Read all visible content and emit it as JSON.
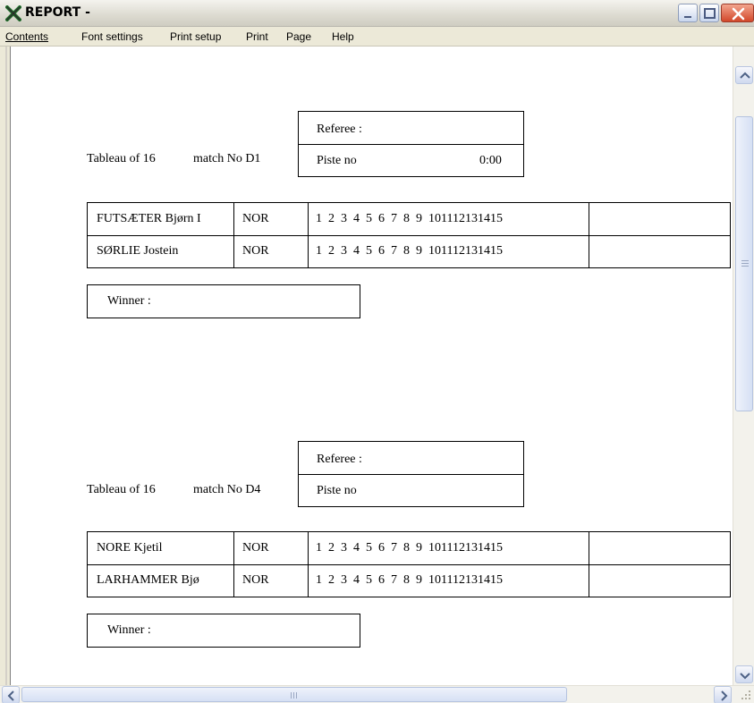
{
  "window": {
    "title": "REPORT -",
    "icon": "x-app-icon",
    "buttons": [
      "minimize",
      "maximize",
      "close"
    ]
  },
  "menu": [
    "Contents",
    "Font settings",
    "Print setup",
    "Print",
    "Page",
    "Help"
  ],
  "matches": [
    {
      "round": "Tableau of 16",
      "match_no": "match No D1",
      "referee_label": "Referee :",
      "piste_label": "Piste no",
      "time": "0:00",
      "fencers": [
        {
          "name": "FUTSÆTER Bjørn I",
          "nation": "NOR"
        },
        {
          "name": "SØRLIE Jostein",
          "nation": "NOR"
        }
      ],
      "winner_label": "Winner :"
    },
    {
      "round": "Tableau of 16",
      "match_no": "match No D4",
      "referee_label": "Referee :",
      "piste_label": "Piste no",
      "time": "",
      "fencers": [
        {
          "name": "NORE Kjetil",
          "nation": "NOR"
        },
        {
          "name": "LARHAMMER Bjø",
          "nation": "NOR"
        }
      ],
      "winner_label": "Winner :"
    }
  ],
  "touches": [
    "1",
    "2",
    "3",
    "4",
    "5",
    "6",
    "7",
    "8",
    "9",
    "10",
    "11",
    "12",
    "13",
    "14",
    "15"
  ],
  "colors": {
    "titlebar": "#dcdad0",
    "menubar": "#ece9d8",
    "close_button": "#d2482b",
    "scrollbar_thumb": "#d6e0f4"
  }
}
